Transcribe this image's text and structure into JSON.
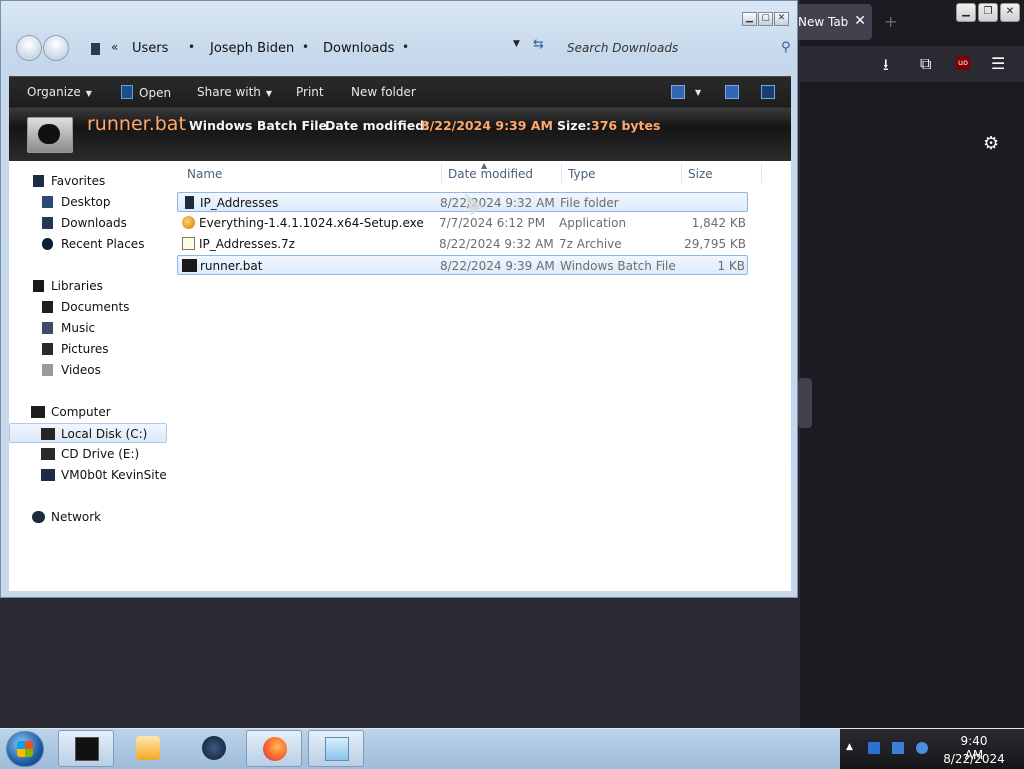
{
  "browser": {
    "tab_label": "New Tab",
    "tab_close": "✕",
    "new_tab": "+",
    "window_controls": [
      "▁",
      "❐",
      "✕"
    ],
    "toolbar_icons": [
      "download-icon",
      "extensions-icon",
      "ublock-icon",
      "menu-icon"
    ],
    "ublock_label": "uo",
    "menu_glyph": "☰",
    "download_glyph": "⭳",
    "extensions_glyph": "⧉",
    "gear_glyph": "⚙"
  },
  "explorer": {
    "window_controls": [
      "▁",
      "▢",
      "✕"
    ],
    "breadcrumb": {
      "overflow": "«",
      "items": [
        "Users",
        "Joseph Biden",
        "Downloads"
      ],
      "separator": "•"
    },
    "dropdown_glyph": "▼",
    "refresh_glyph": "⇆",
    "search_placeholder": "Search Downloads",
    "search_glyph": "⚲",
    "commands": {
      "organize": "Organize",
      "open": "Open",
      "share_with": "Share with",
      "print": "Print",
      "new_folder": "New folder",
      "dropdown_arrow": "▼"
    },
    "details": {
      "name": "runner.bat",
      "type": "Windows Batch File",
      "modified_label": "Date modified:",
      "modified": "8/22/2024 9:39 AM",
      "size_label": "Size:",
      "size": "376 bytes"
    },
    "nav": {
      "favorites": "Favorites",
      "desktop": "Desktop",
      "downloads": "Downloads",
      "recent_places": "Recent Places",
      "libraries": "Libraries",
      "documents": "Documents",
      "music": "Music",
      "pictures": "Pictures",
      "videos": "Videos",
      "computer": "Computer",
      "local_disk": "Local Disk (C:)",
      "cd_drive": "CD Drive (E:)",
      "share": "VM0b0t KevinSite",
      "network": "Network"
    },
    "columns": {
      "name": "Name",
      "date": "Date modified",
      "type": "Type",
      "size": "Size",
      "sort_arrow": "▲"
    },
    "files": [
      {
        "name": "IP_Addresses",
        "date": "8/22/2024 9:32 AM",
        "type": "File folder",
        "size": ""
      },
      {
        "name": "Everything-1.4.1.1024.x64-Setup.exe",
        "date": "7/7/2024 6:12 PM",
        "type": "Application",
        "size": "1,842 KB"
      },
      {
        "name": "IP_Addresses.7z",
        "date": "8/22/2024 9:32 AM",
        "type": "7z Archive",
        "size": "29,795 KB"
      },
      {
        "name": "runner.bat",
        "date": "8/22/2024 9:39 AM",
        "type": "Windows Batch File",
        "size": "1 KB"
      }
    ]
  },
  "taskbar": {
    "tray_arrow": "▲",
    "time": "9:40 AM",
    "date": "8/22/2024"
  }
}
